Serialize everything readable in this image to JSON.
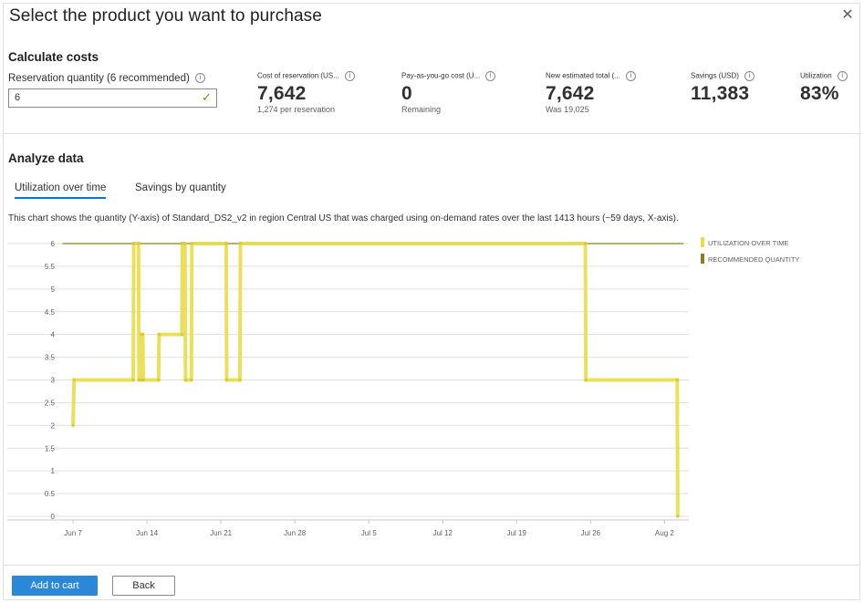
{
  "dialog": {
    "title": "Select the product you want to purchase",
    "close_glyph": "✕"
  },
  "calculate": {
    "heading": "Calculate costs",
    "quantity_label": "Reservation quantity (6 recommended)",
    "quantity_value": "6",
    "info_glyph": "i",
    "check_glyph": "✓"
  },
  "metrics": [
    {
      "label": "Cost of reservation (US...",
      "value": "7,642",
      "sub": "1,274 per reservation"
    },
    {
      "label": "Pay-as-you-go cost (U...",
      "value": "0",
      "sub": "Remaining"
    },
    {
      "label": "New estimated total (...",
      "value": "7,642",
      "sub": "Was 19,025"
    },
    {
      "label": "Savings (USD)",
      "value": "11,383",
      "sub": ""
    },
    {
      "label": "Utilization",
      "value": "83%",
      "sub": ""
    }
  ],
  "analyze": {
    "heading": "Analyze data",
    "tabs": [
      {
        "label": "Utilization over time",
        "active": true
      },
      {
        "label": "Savings by quantity",
        "active": false
      }
    ],
    "description": "This chart shows the quantity (Y-axis) of Standard_DS2_v2 in region Central US that was charged using on-demand rates over the last 1413 hours (~59 days, X-axis)."
  },
  "chart_data": {
    "type": "line",
    "title": "",
    "xlabel": "",
    "ylabel": "",
    "ylim": [
      0,
      6
    ],
    "y_ticks": [
      "0",
      "0.5",
      "1",
      "1.5",
      "2",
      "2.5",
      "3",
      "3.5",
      "4",
      "4.5",
      "5",
      "5.5",
      "6"
    ],
    "x_ticks": [
      "Jun 7",
      "Jun 14",
      "Jun 21",
      "Jun 28",
      "Jul 5",
      "Jul 12",
      "Jul 19",
      "Jul 26",
      "Aug 2"
    ],
    "x_unit": "days since Jun 7",
    "grid": true,
    "legend_position": "right",
    "series": [
      {
        "name": "UTILIZATION OVER TIME",
        "color": "#e8dd4a",
        "points": [
          [
            0,
            2
          ],
          [
            0.1,
            3
          ],
          [
            5.7,
            3
          ],
          [
            5.75,
            6
          ],
          [
            6.2,
            6
          ],
          [
            6.25,
            3
          ],
          [
            6.4,
            3
          ],
          [
            6.45,
            4
          ],
          [
            6.6,
            4
          ],
          [
            6.65,
            3
          ],
          [
            8.1,
            3
          ],
          [
            8.15,
            4
          ],
          [
            10.3,
            4
          ],
          [
            10.35,
            6
          ],
          [
            10.6,
            6
          ],
          [
            10.65,
            3
          ],
          [
            11.2,
            3
          ],
          [
            11.25,
            6
          ],
          [
            14.5,
            6
          ],
          [
            14.55,
            3
          ],
          [
            15.8,
            3
          ],
          [
            15.85,
            6
          ],
          [
            48.5,
            6
          ],
          [
            48.55,
            3
          ],
          [
            57.2,
            3
          ],
          [
            57.25,
            0
          ]
        ]
      },
      {
        "name": "RECOMMENDED QUANTITY",
        "color": "#8a7f19",
        "points": [
          [
            -1,
            6
          ],
          [
            57.8,
            6
          ]
        ]
      }
    ]
  },
  "footer": {
    "primary_label": "Add to cart",
    "secondary_label": "Back"
  }
}
